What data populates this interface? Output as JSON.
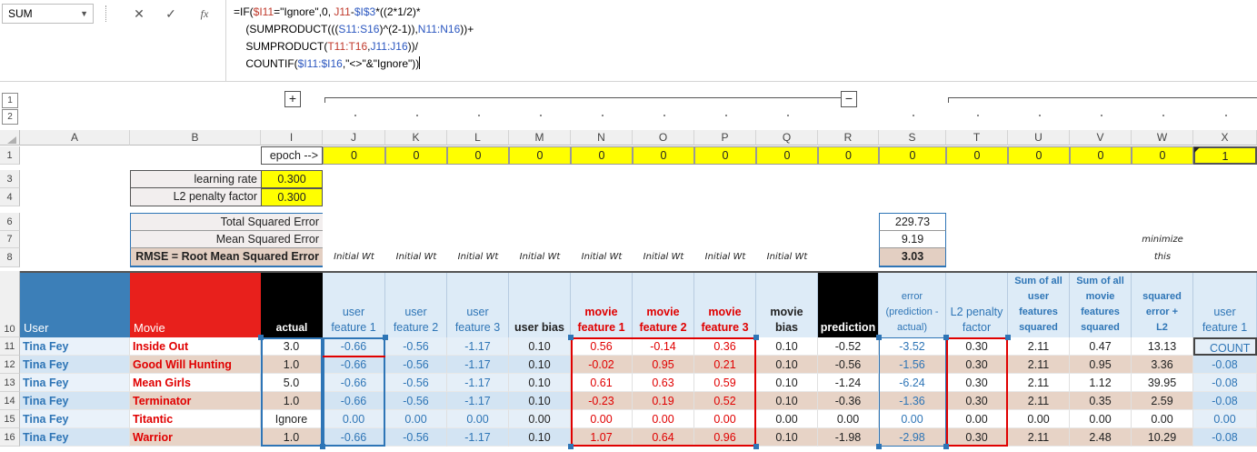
{
  "name_box": {
    "value": "SUM",
    "dropdown_icon": "chevron-down-icon"
  },
  "formula_bar": {
    "buttons": [
      {
        "name": "cancel",
        "glyph": "✕"
      },
      {
        "name": "enter",
        "glyph": "✓"
      },
      {
        "name": "function",
        "glyph": "fx"
      }
    ],
    "lines": [
      [
        [
          "=IF(",
          ""
        ],
        [
          "$I11",
          "r1"
        ],
        [
          "=\"Ignore\",0, ",
          ""
        ],
        [
          "J11",
          "r1"
        ],
        [
          "-",
          ""
        ],
        [
          "$I$3",
          "r2"
        ],
        [
          "*((2*1/2)*",
          ""
        ]
      ],
      [
        [
          "    (SUMPRODUCT(((",
          ""
        ],
        [
          "S11:S16",
          "r2"
        ],
        [
          ")^(2-1)),",
          ""
        ],
        [
          "N11:N16",
          "r2"
        ],
        [
          "))+",
          ""
        ]
      ],
      [
        [
          "    SUMPRODUCT(",
          ""
        ],
        [
          "T11:T16",
          "r1"
        ],
        [
          ",",
          ""
        ],
        [
          "J11:J16",
          "r2"
        ],
        [
          "))/",
          ""
        ]
      ],
      [
        [
          "    COUNTIF(",
          ""
        ],
        [
          "$I11:$I16",
          "r2"
        ],
        [
          ",\"<>\"&\"Ignore\"))",
          ""
        ]
      ]
    ]
  },
  "outline": {
    "levels": [
      "1",
      "2"
    ],
    "expand_button": "+",
    "collapse_button": "−"
  },
  "columns": [
    "A",
    "B",
    "I",
    "J",
    "K",
    "L",
    "M",
    "N",
    "O",
    "P",
    "Q",
    "R",
    "S",
    "T",
    "U",
    "V",
    "W",
    "X"
  ],
  "rows": [
    "1",
    "3",
    "4",
    "6",
    "7",
    "8",
    "10",
    "11",
    "12",
    "13",
    "14",
    "15",
    "16"
  ],
  "epoch": {
    "label": "epoch -->",
    "values": [
      "0",
      "0",
      "0",
      "0",
      "0",
      "0",
      "0",
      "0",
      "0",
      "0",
      "0",
      "0",
      "0",
      "0",
      "1"
    ]
  },
  "params": [
    {
      "label": "learning rate",
      "value": "0.300"
    },
    {
      "label": "L2 penalty factor",
      "value": "0.300"
    }
  ],
  "errors": [
    {
      "label": "Total Squared Error",
      "value": "229.73"
    },
    {
      "label": "Mean Squared Error",
      "value": "9.19"
    },
    {
      "label": "RMSE = Root Mean Squared Error",
      "value": "3.03"
    }
  ],
  "initial_wt": "Initial Wt",
  "minimize": [
    "minimize",
    "this"
  ],
  "headers": {
    "user": "User",
    "movie": "Movie",
    "actual": "actual",
    "j": [
      "user",
      "feature 1"
    ],
    "k": [
      "user",
      "feature 2"
    ],
    "l": [
      "user",
      "feature 3"
    ],
    "m": [
      "user bias"
    ],
    "n": [
      "movie",
      "feature 1"
    ],
    "o": [
      "movie",
      "feature 2"
    ],
    "p": [
      "movie",
      "feature 3"
    ],
    "q": [
      "movie",
      "bias"
    ],
    "r": [
      "prediction"
    ],
    "s": [
      "error",
      "(prediction -",
      "actual)"
    ],
    "t": [
      "L2 penalty",
      "factor"
    ],
    "u": [
      "Sum of all",
      "user",
      "features",
      "squared"
    ],
    "v": [
      "Sum of all",
      "movie",
      "features",
      "squared"
    ],
    "w": [
      "squared",
      "error +",
      "L2"
    ],
    "x": [
      "user",
      "feature 1"
    ]
  },
  "table": [
    [
      "Tina Fey",
      "Inside Out",
      "3.0",
      "-0.66",
      "-0.56",
      "-1.17",
      "0.10",
      "0.56",
      "-0.14",
      "0.36",
      "0.10",
      "-0.52",
      "-3.52",
      "0.30",
      "2.11",
      "0.47",
      "13.13",
      "COUNT"
    ],
    [
      "Tina Fey",
      "Good Will Hunting",
      "1.0",
      "-0.66",
      "-0.56",
      "-1.17",
      "0.10",
      "-0.02",
      "0.95",
      "0.21",
      "0.10",
      "-0.56",
      "-1.56",
      "0.30",
      "2.11",
      "0.95",
      "3.36",
      "-0.08"
    ],
    [
      "Tina Fey",
      "Mean Girls",
      "5.0",
      "-0.66",
      "-0.56",
      "-1.17",
      "0.10",
      "0.61",
      "0.63",
      "0.59",
      "0.10",
      "-1.24",
      "-6.24",
      "0.30",
      "2.11",
      "1.12",
      "39.95",
      "-0.08"
    ],
    [
      "Tina Fey",
      "Terminator",
      "1.0",
      "-0.66",
      "-0.56",
      "-1.17",
      "0.10",
      "-0.23",
      "0.19",
      "0.52",
      "0.10",
      "-0.36",
      "-1.36",
      "0.30",
      "2.11",
      "0.35",
      "2.59",
      "-0.08"
    ],
    [
      "Tina Fey",
      "Titantic",
      "Ignore",
      "0.00",
      "0.00",
      "0.00",
      "0.00",
      "0.00",
      "0.00",
      "0.00",
      "0.00",
      "0.00",
      "0.00",
      "0.00",
      "0.00",
      "0.00",
      "0.00",
      "0.00"
    ],
    [
      "Tina Fey",
      "Warrior",
      "1.0",
      "-0.66",
      "-0.56",
      "-1.17",
      "0.10",
      "1.07",
      "0.64",
      "0.96",
      "0.10",
      "-1.98",
      "-2.98",
      "0.30",
      "2.11",
      "2.48",
      "10.29",
      "-0.08"
    ]
  ],
  "colors": {
    "user_header": "#3c7fb8",
    "movie_header": "#e8201c",
    "user_blue": "#2e75b6",
    "movie_red": "#e00000",
    "yellow": "#ffff00",
    "user_fill": "#ddebf7",
    "band": "#e7d3c6"
  }
}
